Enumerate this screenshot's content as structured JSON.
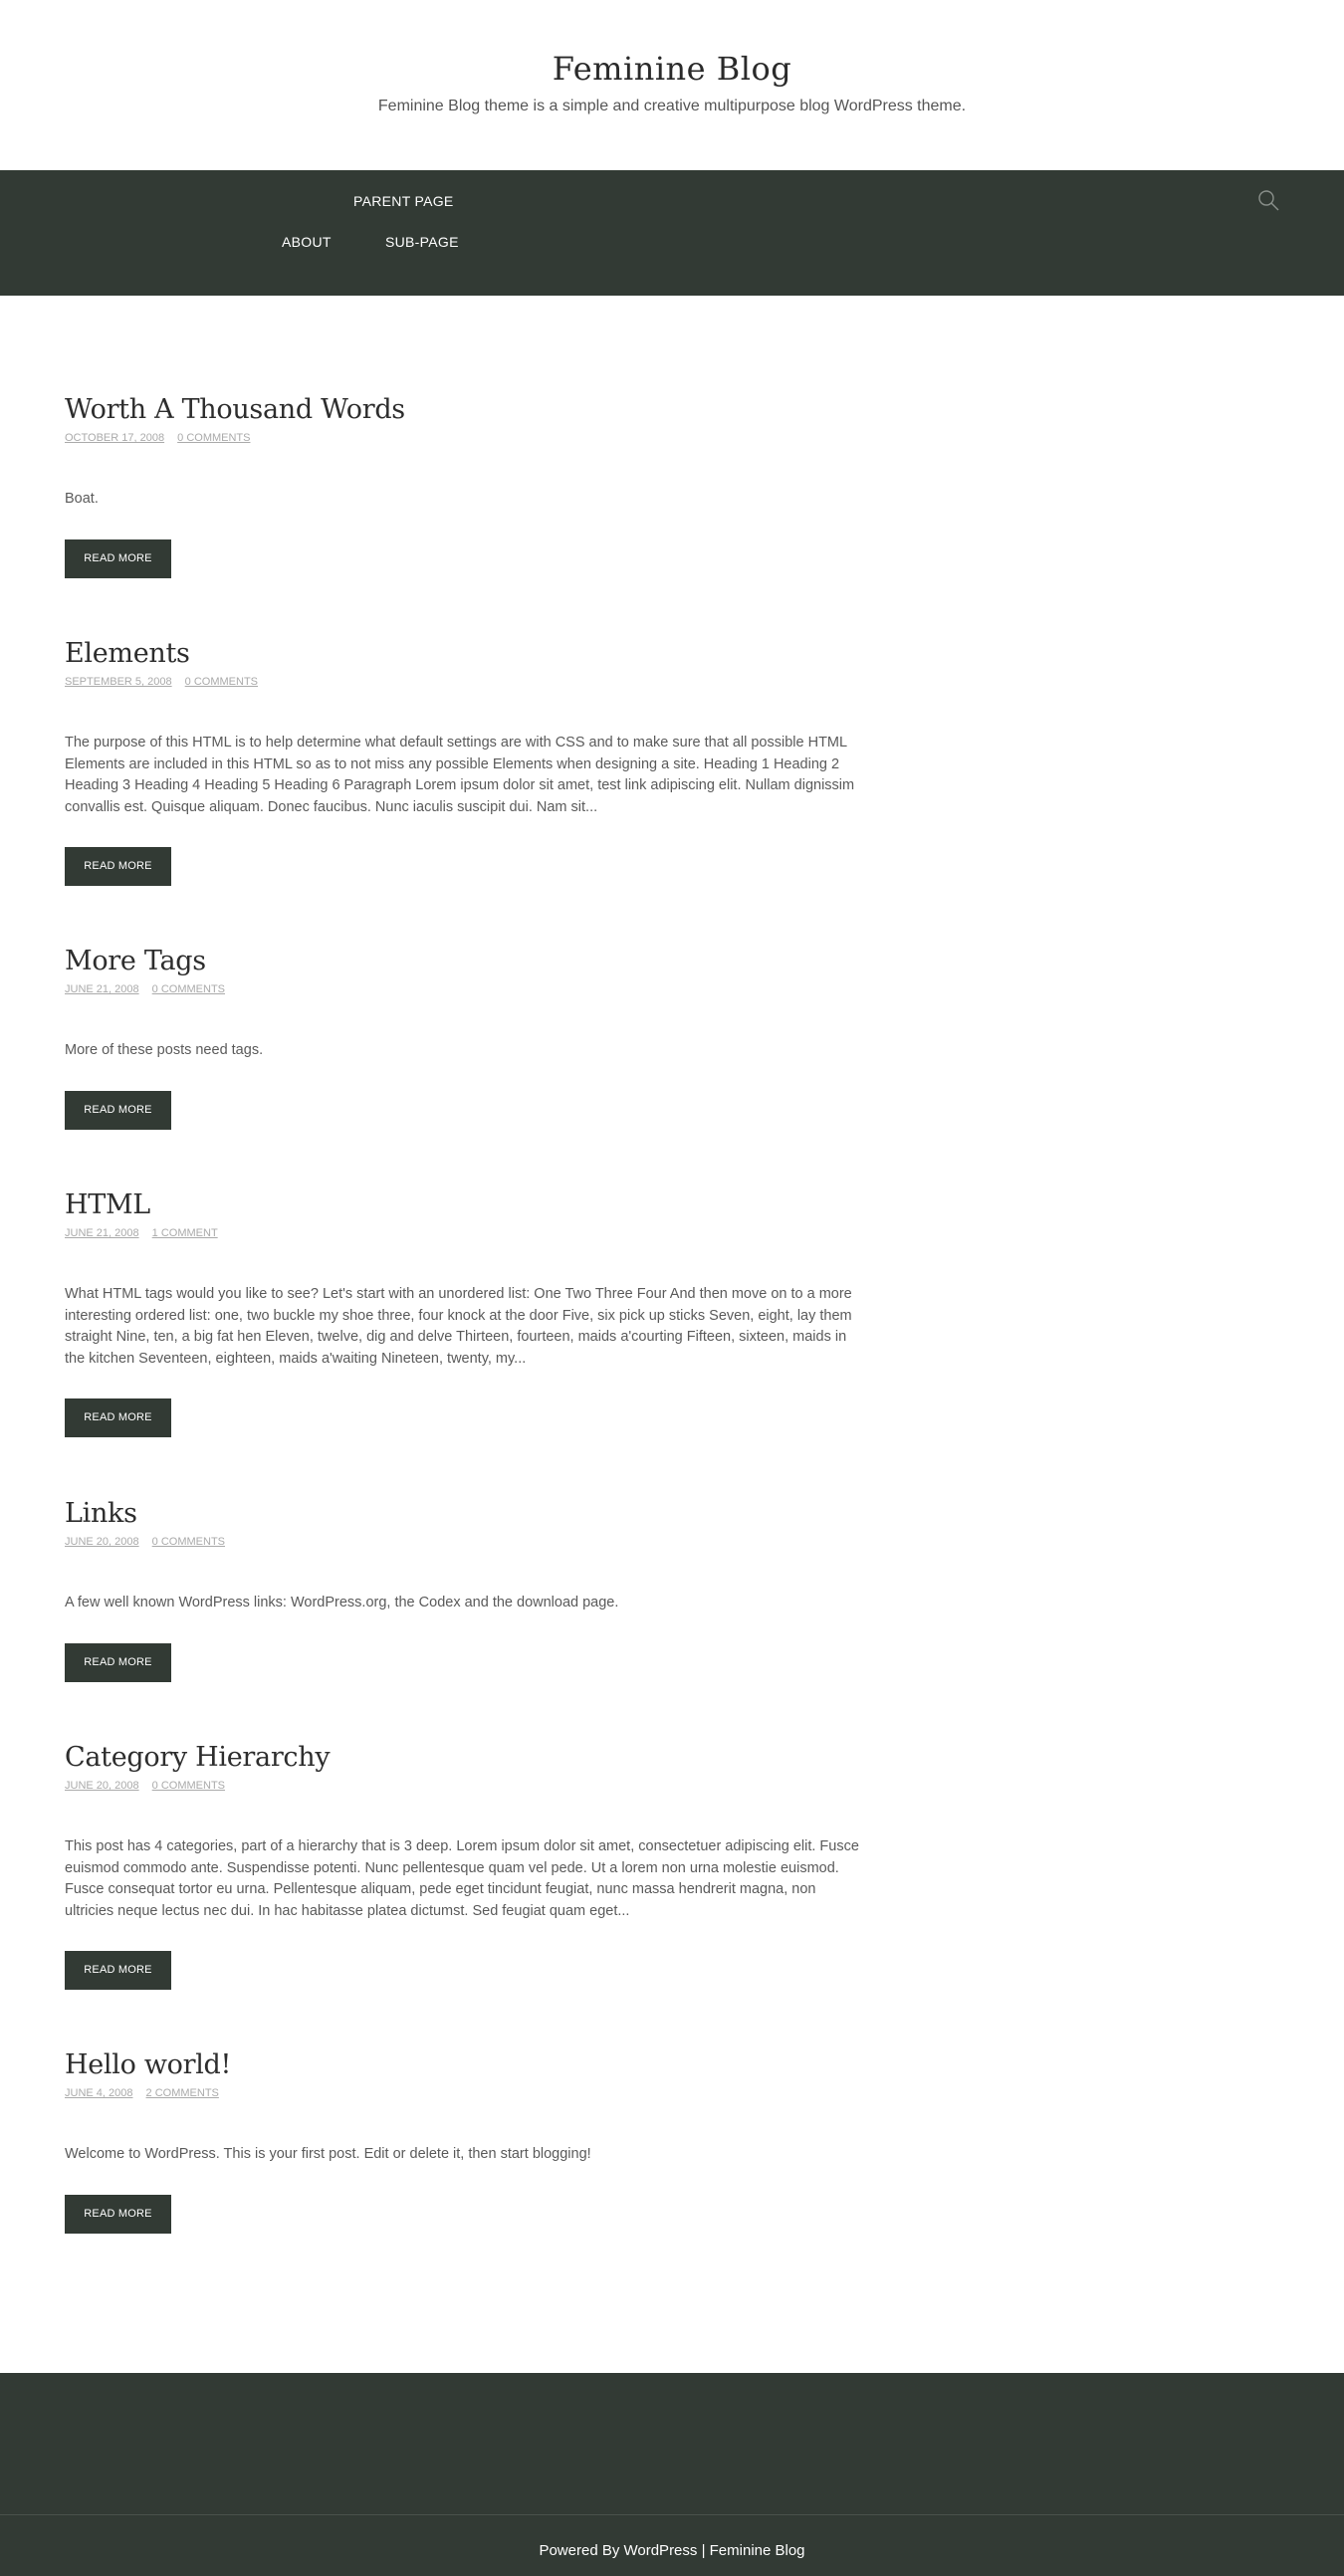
{
  "header": {
    "title": "Feminine Blog",
    "tagline": "Feminine Blog theme is a simple and creative multipurpose blog WordPress theme."
  },
  "nav": {
    "items": [
      {
        "label": "PARENT PAGE"
      },
      {
        "label": "ABOUT"
      },
      {
        "label": "SUB-PAGE"
      }
    ],
    "search_icon": "search-icon"
  },
  "posts": [
    {
      "title": "Worth A Thousand Words",
      "date": "OCTOBER 17, 2008",
      "comments": "0 COMMENTS",
      "excerpt": "Boat.",
      "read_more": "READ MORE"
    },
    {
      "title": "Elements",
      "date": "SEPTEMBER 5, 2008",
      "comments": "0 COMMENTS",
      "excerpt": "The purpose of this HTML is to help determine what default settings are with CSS and to make sure that all possible HTML Elements are included in this HTML so as to not miss any possible Elements when designing a site. Heading 1 Heading 2 Heading 3 Heading 4 Heading 5 Heading 6 Paragraph Lorem ipsum dolor sit amet, test link adipiscing elit. Nullam dignissim convallis est. Quisque aliquam. Donec faucibus. Nunc iaculis suscipit dui. Nam sit...",
      "read_more": "READ MORE"
    },
    {
      "title": "More Tags",
      "date": "JUNE 21, 2008",
      "comments": "0 COMMENTS",
      "excerpt": "More of these posts need tags.",
      "read_more": "READ MORE"
    },
    {
      "title": "HTML",
      "date": "JUNE 21, 2008",
      "comments": "1 COMMENT",
      "excerpt": "What HTML tags would you like to see? Let's start with an unordered list: One Two Three Four And then move on to a more interesting ordered list: one, two buckle my shoe three, four knock at the door Five, six pick up sticks Seven, eight, lay them straight Nine, ten, a big fat hen Eleven, twelve, dig and delve Thirteen, fourteen, maids a'courting Fifteen, sixteen, maids in the kitchen Seventeen, eighteen, maids a'waiting Nineteen, twenty, my...",
      "read_more": "READ MORE"
    },
    {
      "title": "Links",
      "date": "JUNE 20, 2008",
      "comments": "0 COMMENTS",
      "excerpt": "A few well known WordPress links: WordPress.org, the Codex and the download page.",
      "read_more": "READ MORE"
    },
    {
      "title": "Category Hierarchy",
      "date": "JUNE 20, 2008",
      "comments": "0 COMMENTS",
      "excerpt": "This post has 4 categories, part of a hierarchy that is 3 deep. Lorem ipsum dolor sit amet, consectetuer adipiscing elit. Fusce euismod commodo ante. Suspendisse potenti. Nunc pellentesque quam vel pede. Ut a lorem non urna molestie euismod. Fusce consequat tortor eu urna. Pellentesque aliquam, pede eget tincidunt feugiat, nunc massa hendrerit magna, non ultricies neque lectus nec dui. In hac habitasse platea dictumst. Sed feugiat quam eget...",
      "read_more": "READ MORE"
    },
    {
      "title": "Hello world!",
      "date": "JUNE 4, 2008",
      "comments": "2 COMMENTS",
      "excerpt": "Welcome to WordPress. This is your first post. Edit or delete it, then start blogging!",
      "read_more": "READ MORE"
    }
  ],
  "footer": {
    "powered_by": "Powered By WordPress",
    "separator": " | ",
    "site_link": "Feminine Blog"
  },
  "colors": {
    "dark_green": "#323a34",
    "meta_gray": "#aaaaaa"
  }
}
